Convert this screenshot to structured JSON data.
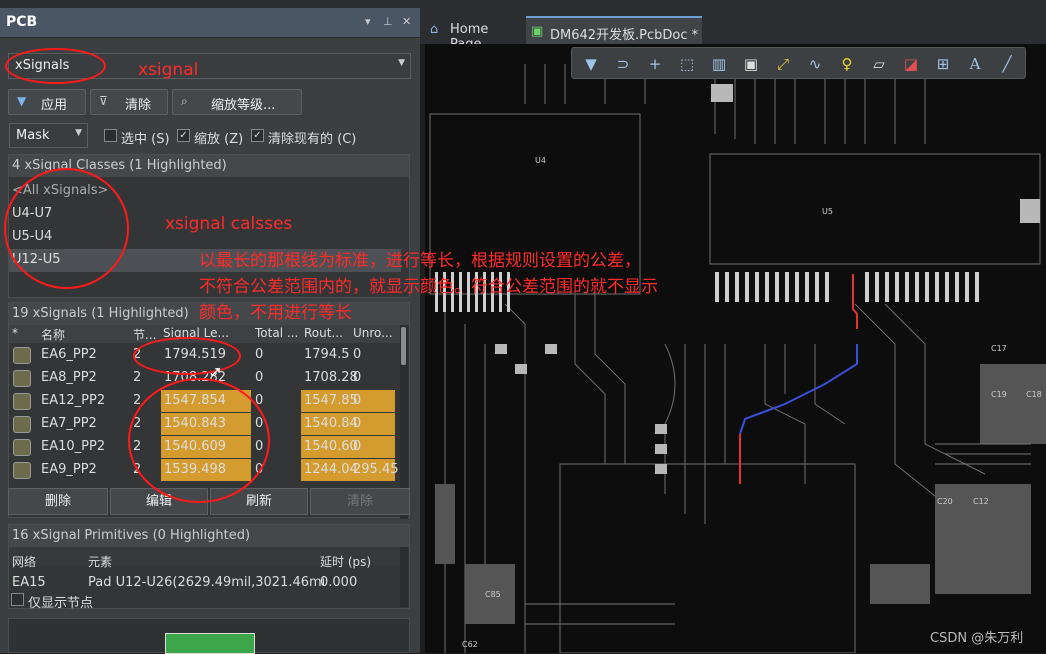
{
  "panel": {
    "title": "PCB",
    "object_kind": "xSignals",
    "buttons": {
      "apply": "应用",
      "clear": "清除",
      "zoom_level": "缩放等级..."
    },
    "mode": "Mask",
    "checkboxes": [
      {
        "label": "选中 (S)",
        "checked": false
      },
      {
        "label": "缩放 (Z)",
        "checked": true
      },
      {
        "label": "清除现有的 (C)",
        "checked": true
      }
    ],
    "classes": {
      "header": "4 xSignal Classes (1 Highlighted)",
      "items": [
        "<All xSignals>",
        "U4-U7",
        "U5-U4",
        "U12-U5"
      ],
      "selected_index": 3
    },
    "signals": {
      "header": "19 xSignals (1 Highlighted)",
      "columns": [
        "*",
        "名称",
        "节...",
        "Signal Le...",
        "Total ...",
        "Rout...",
        "Unro..."
      ],
      "rows": [
        {
          "name": "EA6_PP2",
          "nodes": "2",
          "signal_length": "1794.519",
          "total": "0",
          "routed": "1794.5",
          "unrouted": "0",
          "highlight": false
        },
        {
          "name": "EA8_PP2",
          "nodes": "2",
          "signal_length": "1708.282",
          "total": "0",
          "routed": "1708.28",
          "unrouted": "0",
          "highlight": false
        },
        {
          "name": "EA12_PP2",
          "nodes": "2",
          "signal_length": "1547.854",
          "total": "0",
          "routed": "1547.85",
          "unrouted": "0",
          "highlight": true
        },
        {
          "name": "EA7_PP2",
          "nodes": "2",
          "signal_length": "1540.843",
          "total": "0",
          "routed": "1540.84",
          "unrouted": "0",
          "highlight": true
        },
        {
          "name": "EA10_PP2",
          "nodes": "2",
          "signal_length": "1540.609",
          "total": "0",
          "routed": "1540.60",
          "unrouted": "0",
          "highlight": true
        },
        {
          "name": "EA9_PP2",
          "nodes": "2",
          "signal_length": "1539.498",
          "total": "0",
          "routed": "1244.04",
          "unrouted": "295.45",
          "highlight": true
        }
      ],
      "highlight_color": "#d49b2e"
    },
    "bottom_buttons": [
      "删除",
      "编辑",
      "刷新",
      "清除"
    ],
    "primitives": {
      "header": "16 xSignal Primitives (0 Highlighted)",
      "columns": [
        "网络",
        "元素",
        "延时 (ps)"
      ],
      "rows": [
        {
          "net": "EA15",
          "element": "Pad U12-U26(2629.49mil,3021.46mi",
          "delay": "0.000"
        }
      ]
    },
    "only_nodes_label": "仅显示节点"
  },
  "tabs": [
    {
      "label": "Home Page",
      "icon": "home-icon",
      "active": false
    },
    {
      "label": "DM642开发板.PcbDoc *",
      "icon": "pcb-doc-icon",
      "active": true
    }
  ],
  "toolbar_icons": [
    "filter-icon",
    "route-icon",
    "add-icon",
    "select-rect-icon",
    "chart-icon",
    "chip-icon",
    "interactive-route-icon",
    "diff-pair-icon",
    "bulb-icon",
    "layer-icon",
    "arc-icon",
    "dimension-icon",
    "text-icon",
    "line-icon"
  ],
  "annotations": {
    "xsignal": "xsignal",
    "classes": "xsignal calsses",
    "note_lines": [
      "以最长的那根线为标准，进行等长，根据规则设置的公差，",
      "不符合公差范围内的，就显示颜色。符合公差范围的就不显示",
      "颜色，不用进行等长"
    ]
  },
  "watermark": "CSDN @朱万利",
  "board_labels": [
    "U5",
    "U4",
    "C19",
    "C17",
    "C18",
    "C12",
    "C85",
    "C62",
    "C20"
  ]
}
